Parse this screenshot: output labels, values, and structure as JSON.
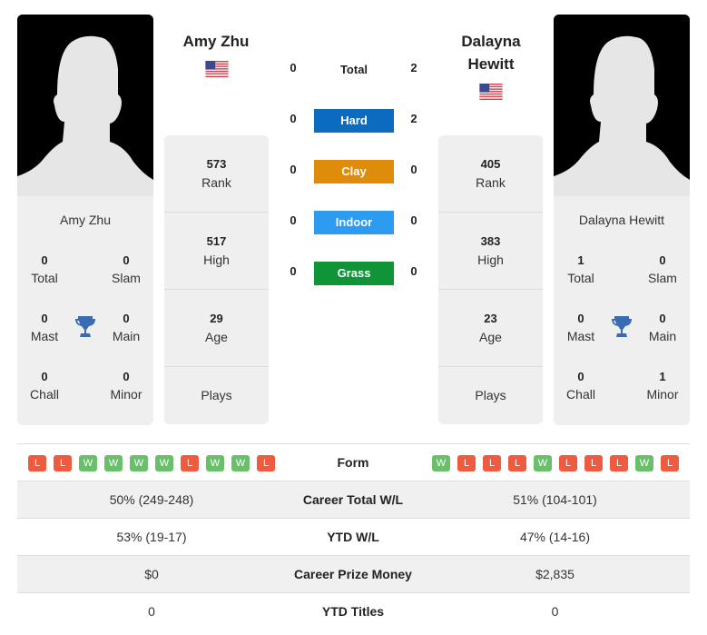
{
  "player1": {
    "name": "Amy Zhu",
    "country_flag": "us-flag",
    "card_name": "Amy Zhu",
    "titles": {
      "total": {
        "value": "0",
        "label": "Total"
      },
      "slam": {
        "value": "0",
        "label": "Slam"
      },
      "mast": {
        "value": "0",
        "label": "Mast"
      },
      "main": {
        "value": "0",
        "label": "Main"
      },
      "chall": {
        "value": "0",
        "label": "Chall"
      },
      "minor": {
        "value": "0",
        "label": "Minor"
      }
    },
    "info": {
      "rank": {
        "value": "573",
        "label": "Rank"
      },
      "high": {
        "value": "517",
        "label": "High"
      },
      "age": {
        "value": "29",
        "label": "Age"
      },
      "plays": {
        "value": "",
        "label": "Plays"
      }
    },
    "form": [
      "L",
      "L",
      "W",
      "W",
      "W",
      "W",
      "L",
      "W",
      "W",
      "L"
    ]
  },
  "player2": {
    "name": "Dalayna Hewitt",
    "name_line1": "Dalayna",
    "name_line2": "Hewitt",
    "country_flag": "us-flag",
    "card_name": "Dalayna Hewitt",
    "titles": {
      "total": {
        "value": "1",
        "label": "Total"
      },
      "slam": {
        "value": "0",
        "label": "Slam"
      },
      "mast": {
        "value": "0",
        "label": "Mast"
      },
      "main": {
        "value": "0",
        "label": "Main"
      },
      "chall": {
        "value": "0",
        "label": "Chall"
      },
      "minor": {
        "value": "1",
        "label": "Minor"
      }
    },
    "info": {
      "rank": {
        "value": "405",
        "label": "Rank"
      },
      "high": {
        "value": "383",
        "label": "High"
      },
      "age": {
        "value": "23",
        "label": "Age"
      },
      "plays": {
        "value": "",
        "label": "Plays"
      }
    },
    "form": [
      "W",
      "L",
      "L",
      "L",
      "W",
      "L",
      "L",
      "L",
      "W",
      "L"
    ]
  },
  "h2h": [
    {
      "label": "Total",
      "p1": "0",
      "p2": "2",
      "color": ""
    },
    {
      "label": "Hard",
      "p1": "0",
      "p2": "2",
      "color": "#0b6bbf"
    },
    {
      "label": "Clay",
      "p1": "0",
      "p2": "0",
      "color": "#de8c09"
    },
    {
      "label": "Indoor",
      "p1": "0",
      "p2": "0",
      "color": "#2d9bf0"
    },
    {
      "label": "Grass",
      "p1": "0",
      "p2": "0",
      "color": "#0f9437"
    }
  ],
  "table": {
    "form_label": "Form",
    "rows": [
      {
        "label": "Career Total W/L",
        "p1": "50% (249-248)",
        "p2": "51% (104-101)"
      },
      {
        "label": "YTD W/L",
        "p1": "53% (19-17)",
        "p2": "47% (14-16)"
      },
      {
        "label": "Career Prize Money",
        "p1": "$0",
        "p2": "$2,835"
      },
      {
        "label": "YTD Titles",
        "p1": "0",
        "p2": "0"
      }
    ]
  },
  "colors": {
    "win": "#6abf6a",
    "loss": "#ef5b3e",
    "trophy": "#3a6cb4"
  }
}
